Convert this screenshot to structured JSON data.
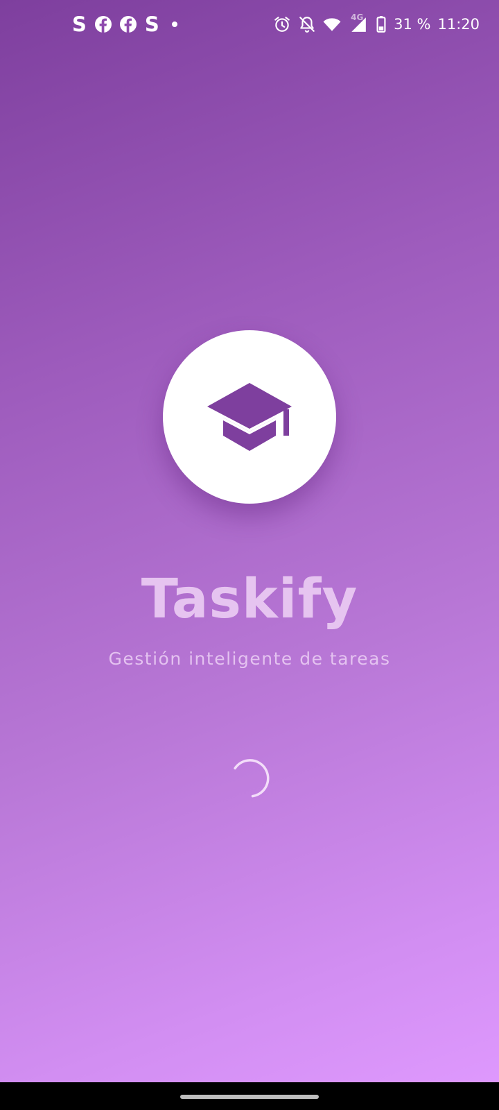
{
  "status_bar": {
    "left_icons": [
      "S",
      "facebook-icon",
      "facebook-icon",
      "S",
      "dot"
    ],
    "letter_s": "S",
    "battery_text": "31 %",
    "time": "11:20",
    "network_label": "4G"
  },
  "app": {
    "title": "Taskify",
    "subtitle": "Gestión inteligente de tareas",
    "logo_icon": "graduation-cap-icon"
  },
  "colors": {
    "accent": "#7e3f9e",
    "gradient_start": "#7e3f9e",
    "gradient_end": "#e09aff",
    "title_color": "#e6c4f0"
  }
}
